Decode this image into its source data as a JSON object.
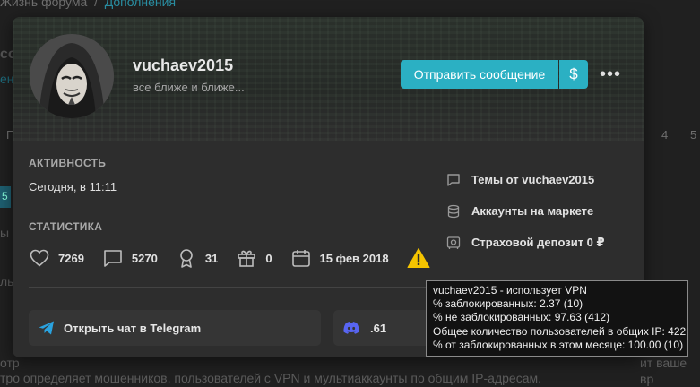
{
  "background": {
    "breadcrumb_part1": "Жизнь форума",
    "breadcrumb_sep": "/",
    "breadcrumb_part2": "Дополнения",
    "left_frag_1": "со",
    "left_frag_2": "ен",
    "left_frag_3": "ы",
    "left_frag_4": "ль",
    "left_tab": "5",
    "pages_left": "П",
    "pages_right_1": "4",
    "pages_right_2": "5",
    "bottom_line_1": "отр",
    "bottom_line_1_right": "ит ваше вр",
    "bottom_line_2": "тро определяет мошенников, пользователей с VPN и мультиаккаунты по общим IP-адресам."
  },
  "profile": {
    "username": "vuchaev2015",
    "status": "все ближе и ближе...",
    "send_message": "Отправить сообщение",
    "dollar_icon_char": "$",
    "more_char": "•••"
  },
  "activity": {
    "title": "АКТИВНОСТЬ",
    "value": "Сегодня, в 11:11"
  },
  "statistics": {
    "title": "СТАТИСТИКА",
    "likes": "7269",
    "messages": "5270",
    "trophies": "31",
    "gifts": "0",
    "registered": "15 фев 2018"
  },
  "links": {
    "threads": "Темы от vuchaev2015",
    "market": "Аккаунты на маркете",
    "deposit": "Страховой депозит 0 ₽"
  },
  "contacts": {
    "telegram": "Открыть чат в Telegram",
    "discord": ".61"
  },
  "tooltip": {
    "line1": "vuchaev2015 - использует VPN",
    "line2": "% заблокированных: 2.37 (10)",
    "line3": "% не заблокированных: 97.63 (412)",
    "line4": "Общее количество пользователей в общих IP: 422",
    "line5": "% от заблокированных в этом месяце: 100.00 (10)"
  },
  "colors": {
    "accent": "#2bb0c3",
    "warning": "#f5c400",
    "telegram": "#2aa3e0",
    "discord": "#5865f2"
  }
}
